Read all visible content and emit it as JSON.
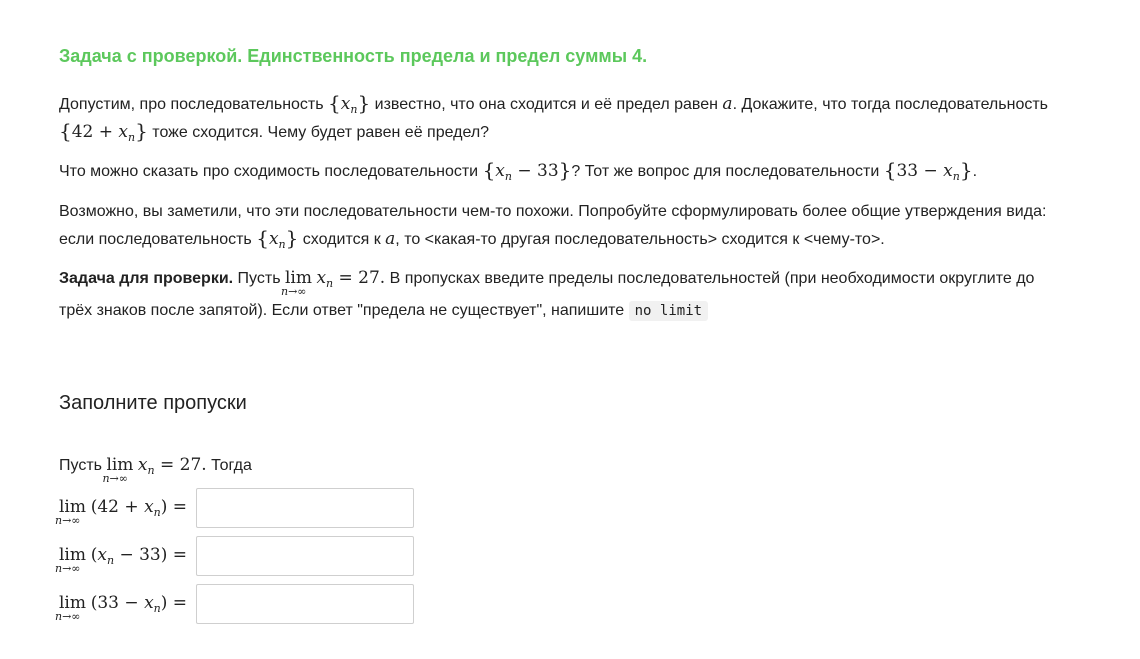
{
  "task": {
    "title": "Задача с проверкой. Единственность предела и предел суммы 4.",
    "p1": {
      "t1": "Допустим, про последовательность ",
      "t2": " известно, что она сходится и её предел равен ",
      "t3": ". Докажите, что тогда последовательность",
      "t4": " тоже сходится. Чему будет равен её предел?"
    },
    "p2": {
      "t1": "Что можно сказать про сходимость последовательности ",
      "t2": "? Тот же вопрос для последовательности ",
      "t3": "."
    },
    "p3": {
      "t1": "Возможно, вы заметили, что эти последовательности чем-то похожи. Попробуйте сформулировать более общие утверждения вида:",
      "t2": "если последовательность ",
      "t3": " сходится к ",
      "t4": ", то <какая-то другая последовательность> сходится к <чему-то>."
    },
    "p4": {
      "bold": "Задача для проверки.",
      "t1": " Пусть ",
      "t2": " В пропусках введите пределы последовательностей (при необходимости округлите до трёх знаков после запятой). Если ответ \"предела не существует\", напишите ",
      "code": "no limit"
    }
  },
  "math": {
    "x": "x",
    "n": "n",
    "a": "a",
    "lim": "lim",
    "n_to_inf": "n→∞",
    "eq27": " = 27.",
    "seq_xn": "{x_n}",
    "seq_42_plus_xn": "{42 + x_n}",
    "seq_xn_minus_33": "{x_n − 33}",
    "seq_33_minus_xn": "{33 − x_n}"
  },
  "fill": {
    "heading": "Заполните пропуски",
    "intro_prefix": "Пусть ",
    "intro_suffix": " Тогда",
    "rows": [
      {
        "before": "(42 + ",
        "after": ") =",
        "value": ""
      },
      {
        "before": "(",
        "after": " − 33) =",
        "value": ""
      },
      {
        "before": "(33 − ",
        "after": ") =",
        "value": ""
      }
    ]
  },
  "colors": {
    "title_green": "#5cc85c",
    "text": "#222222",
    "input_border": "#cfcfcf",
    "code_bg": "#f1f1f1"
  }
}
